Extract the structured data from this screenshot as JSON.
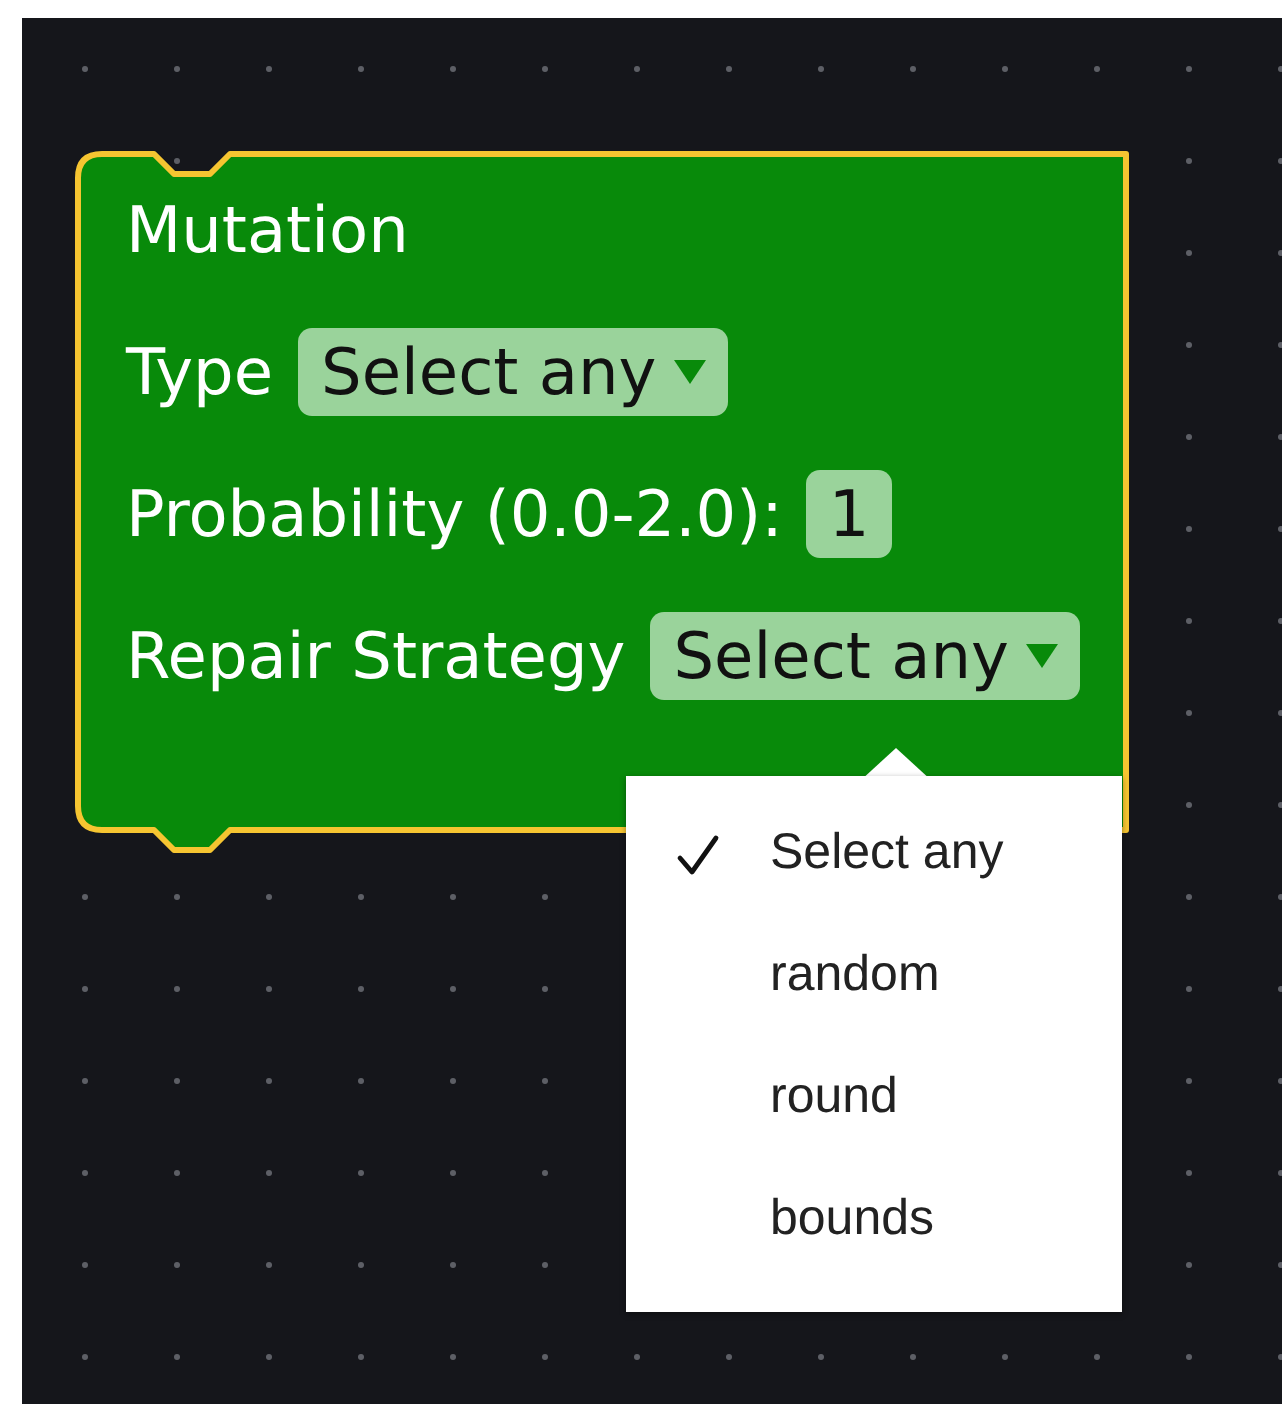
{
  "block": {
    "title": "Mutation",
    "fields": [
      {
        "label": "Type",
        "kind": "dropdown",
        "value": "Select any"
      },
      {
        "label": "Probability (0.0-2.0):",
        "kind": "number",
        "value": "1"
      },
      {
        "label": "Repair Strategy",
        "kind": "dropdown",
        "value": "Select any"
      }
    ]
  },
  "dropdown_menu": {
    "options": [
      {
        "label": "Select any",
        "selected": true
      },
      {
        "label": "random",
        "selected": false
      },
      {
        "label": "round",
        "selected": false
      },
      {
        "label": "bounds",
        "selected": false
      }
    ]
  }
}
